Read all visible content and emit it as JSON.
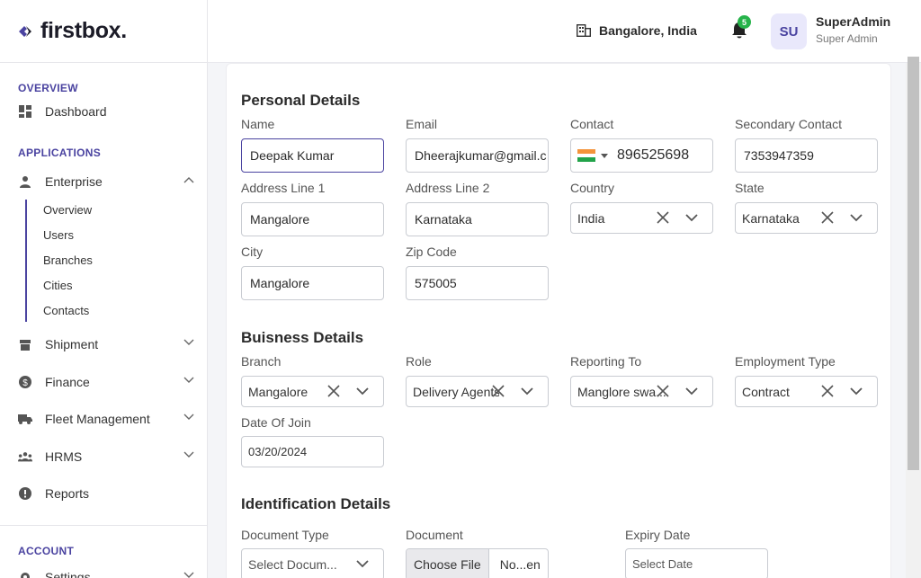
{
  "brand": {
    "name": "firstbox."
  },
  "sidebar": {
    "overview_title": "OVERVIEW",
    "dashboard": "Dashboard",
    "applications_title": "APPLICATIONS",
    "enterprise": "Enterprise",
    "enterprise_sub": [
      "Overview",
      "Users",
      "Branches",
      "Cities",
      "Contacts"
    ],
    "shipment": "Shipment",
    "finance": "Finance",
    "fleet": "Fleet Management",
    "hrms": "HRMS",
    "reports": "Reports",
    "account_title": "ACCOUNT",
    "settings": "Settings"
  },
  "header": {
    "location": "Bangalore, India",
    "notifications": "5",
    "avatar_initials": "SU",
    "user_name": "SuperAdmin",
    "user_role": "Super Admin"
  },
  "personal": {
    "heading": "Personal Details",
    "name_label": "Name",
    "name_value": "Deepak Kumar",
    "email_label": "Email",
    "email_value": "Dheerajkumar@gmail.c",
    "contact_label": "Contact",
    "contact_value": "896525698",
    "secondary_label": "Secondary Contact",
    "secondary_value": "7353947359",
    "addr1_label": "Address Line 1",
    "addr1_value": "Mangalore",
    "addr2_label": "Address Line 2",
    "addr2_value": "Karnataka",
    "country_label": "Country",
    "country_value": "India",
    "state_label": "State",
    "state_value": "Karnataka",
    "city_label": "City",
    "city_value": "Mangalore",
    "zip_label": "Zip Code",
    "zip_value": "575005"
  },
  "business": {
    "heading": "Buisness Details",
    "branch_label": "Branch",
    "branch_value": "Mangalore",
    "role_label": "Role",
    "role_value": "Delivery Agents",
    "reporting_label": "Reporting To",
    "reporting_value": "Manglore swa...",
    "employment_label": "Employment Type",
    "employment_value": "Contract",
    "doj_label": "Date Of Join",
    "doj_value": "03/20/2024"
  },
  "identification": {
    "heading": "Identification Details",
    "doctype_label": "Document Type",
    "doctype_placeholder": "Select Docum...",
    "document_label": "Document",
    "choose_file": "Choose File",
    "file_name": "No...en",
    "expiry_label": "Expiry Date",
    "expiry_placeholder": "Select Date"
  },
  "colors": {
    "accent": "#4a43a0",
    "badge": "#26b34a"
  }
}
